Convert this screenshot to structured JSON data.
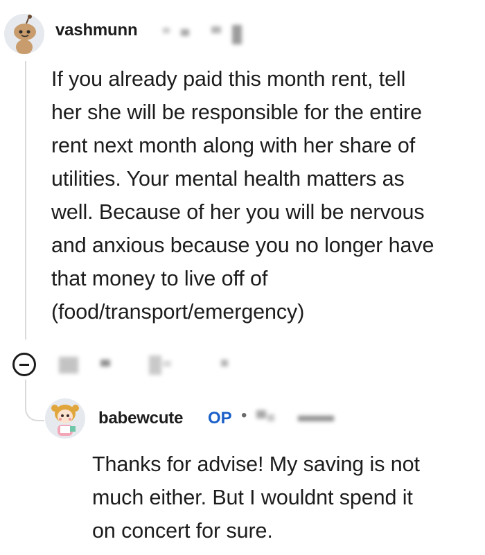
{
  "comment": {
    "username": "vashmunn",
    "body_lines": [
      "If you already paid this month rent, tell",
      "her she will be responsible for the entire",
      "rent next month along with her share of",
      "utilities. Your mental health matters as",
      "well. Because of her you will be nervous",
      "and anxious because you no longer have",
      "that money to live off of",
      "(food/transport/emergency)"
    ],
    "collapse_icon": "collapse-minus-icon"
  },
  "reply": {
    "username": "babewcute",
    "badge": "OP",
    "separator": "•",
    "body_lines": [
      "Thanks for advise! My saving is not",
      "much either. But I wouldnt spend it",
      "on concert for sure."
    ]
  },
  "colors": {
    "op_badge": "#1a5fc8",
    "thread_line": "#d9d9d9",
    "text": "#1c1c1c"
  }
}
